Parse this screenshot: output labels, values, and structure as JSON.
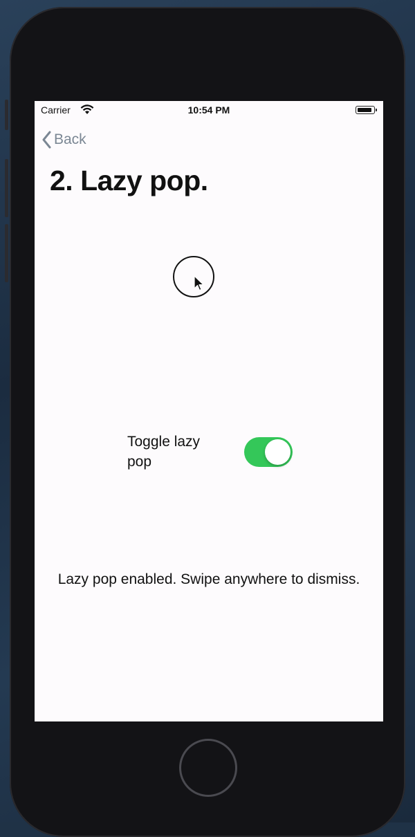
{
  "status_bar": {
    "carrier": "Carrier",
    "time": "10:54 PM"
  },
  "nav": {
    "back_label": "Back"
  },
  "page": {
    "title": "2. Lazy pop.",
    "toggle_label": "Toggle lazy pop",
    "toggle_on": true,
    "status_message": "Lazy pop enabled. Swipe anywhere to dismiss."
  },
  "colors": {
    "switch_on": "#34c759",
    "back_tint": "#7b8794",
    "screen_bg": "#fdfbfd"
  }
}
